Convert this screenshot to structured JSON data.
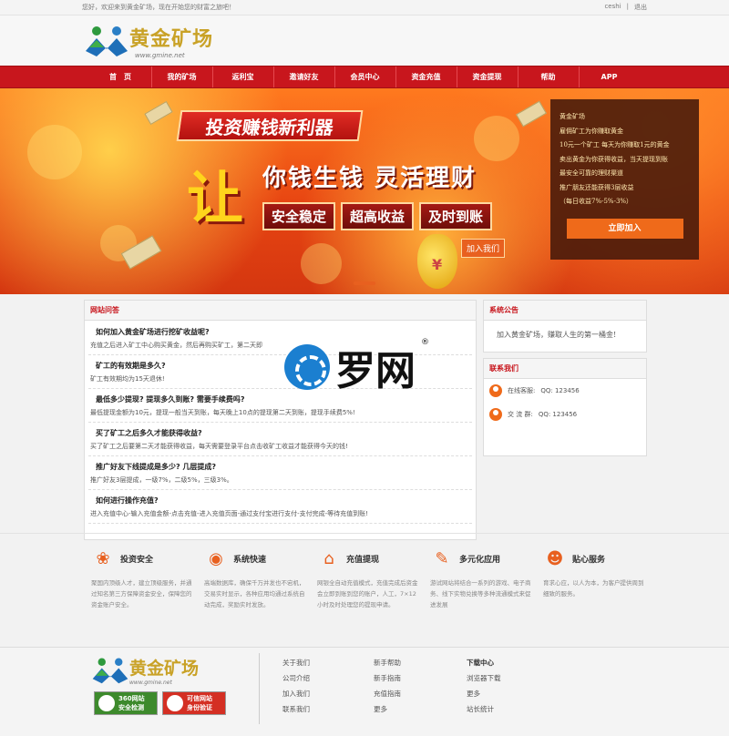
{
  "topbar": {
    "welcome": "您好，欢迎来到黄金矿场，现在开始您的财富之旅吧！",
    "user": "ceshi",
    "separator": "|",
    "logout": "退出"
  },
  "brand": {
    "name": "黄金矿场",
    "url": "www.gmine.net"
  },
  "nav": {
    "items": [
      "首　页",
      "我的矿场",
      "返利宝",
      "邀请好友",
      "会员中心",
      "资金充值",
      "资金提现",
      "帮助",
      "APP"
    ]
  },
  "banner": {
    "slogan": "投资赚钱新利器",
    "big_char": "让",
    "headline": "你钱生钱 灵活理财",
    "tags": [
      "安全稳定",
      "超高收益",
      "及时到账"
    ],
    "join_tag": "加入我们",
    "bag_symbol": "¥",
    "promo_lines": [
      "黄金矿场",
      "雇佣矿工为你赚取黄金",
      "10元一个矿工  每天为你赚取1元的黄金",
      "卖出黄金为你获得收益，当天提现到账",
      "最安全可靠的理财渠道",
      "推广朋友还能获得3层收益",
      "（每日收益7%-5%-3%）"
    ],
    "promo_button": "立即加入"
  },
  "faq": {
    "title": "网站问答",
    "items": [
      {
        "q": "如何加入黄金矿场进行挖矿收益呢?",
        "a": "充值之后进入矿工中心购买黄金，然后再购买矿工，第二天即"
      },
      {
        "q": "矿工的有效期是多久?",
        "a": "矿工有效期均为15天退休!"
      },
      {
        "q": "最低多少提现? 提现多久到账? 需要手续费吗?",
        "a": "最低提现金额为10元，提现一般当天到账，每天晚上10点的提现第二天到账，提现手续费5%!"
      },
      {
        "q": "买了矿工之后多久才能获得收益?",
        "a": "买了矿工之后要第二天才能获得收益，每天需要登录平台点击收矿工收益才能获得今天的钱!"
      },
      {
        "q": "推广好友下线提成是多少? 几层提成?",
        "a": "推广好友3层提成，一级7%，二级5%，三级3%。"
      },
      {
        "q": "如何进行操作充值?",
        "a": "进入充值中心-输入充值金额-点击充值-进入充值页面-通过支付宝进行支付-支付完成-等待充值到账!"
      }
    ]
  },
  "notice": {
    "title": "系统公告",
    "text": "加入黄金矿场，赚取人生的第一桶金!"
  },
  "contact": {
    "title": "联系我们",
    "rows": [
      {
        "label": "在线客服:",
        "value": "QQ: 123456"
      },
      {
        "label": "交 流 群:",
        "value": "QQ: 123456"
      }
    ]
  },
  "watermark": {
    "text": "罗网",
    "reg": "®"
  },
  "features": [
    {
      "icon": "tulip-icon",
      "title": "投资安全",
      "desc": "聚国内顶级人才，建立顶级服务，并通过知名第三方保障资金安全，保障您的资金账户安全。"
    },
    {
      "icon": "speed-icon",
      "title": "系统快速",
      "desc": "高端数据库，确保千万并发也不宕机，交易实时显示，各种应用均通过系统自动完成，奖励实时发放。"
    },
    {
      "icon": "house-icon",
      "title": "充值提现",
      "desc": "网银全自动充值模式，充值完成后资金会立即到账到您的账户，人工，7×12小时及时处理您的提现申请。"
    },
    {
      "icon": "wrench-icon",
      "title": "多元化应用",
      "desc": "游试网站将结合一系列的游戏、电子商务、线下实物兑换等多种流通模式来促进发展"
    },
    {
      "icon": "people-icon",
      "title": "贴心服务",
      "desc": "育求心应，以人为本，为客户提供周到细致的服务。"
    }
  ],
  "footer": {
    "badges": [
      {
        "line1": "360网站",
        "line2": "安全检测"
      },
      {
        "line1": "可信网站",
        "line2": "身份验证"
      }
    ],
    "col1": [
      "关于我们",
      "公司介绍",
      "加入我们",
      "联系我们"
    ],
    "col2": [
      "新手帮助",
      "新手指南",
      "充值指南",
      "更多"
    ],
    "col3_head": "下载中心",
    "col3": [
      "浏览器下载",
      "更多",
      "站长统计"
    ]
  },
  "colors": {
    "brand_red": "#c8161d",
    "gold": "#c9a227",
    "orange": "#ef6a1a"
  }
}
